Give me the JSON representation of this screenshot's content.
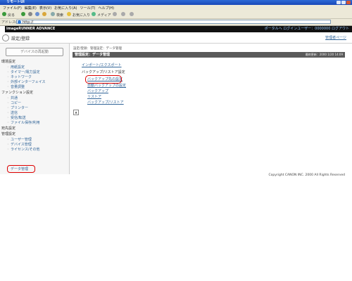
{
  "window": {
    "title": "リモートUI"
  },
  "menubar": {
    "items": [
      "ファイル(F)",
      "編集(E)",
      "表示(V)",
      "お気に入り(A)",
      "ツール(T)",
      "ヘルプ(H)"
    ]
  },
  "toolbar": {
    "back": "戻る",
    "search": "検索",
    "favorites": "お気に入り",
    "media": "メディア"
  },
  "address": {
    "label": "アドレス(D)",
    "value": "http://"
  },
  "app": {
    "brand": "imageRUNNER ADVANCE",
    "logout": "ポータルへ  ログインユーザー：0000000 ログアウト"
  },
  "subheader": {
    "title": "設定/登録",
    "admin_page": "管理者ページ"
  },
  "sidebar": {
    "button": "デバイスの再起動",
    "sections": [
      {
        "heading": "環境設定",
        "items": [
          "用紙設定",
          "タイマー/電力設定",
          "ネットワーク",
          "外部インターフェイス",
          "音量調整"
        ]
      },
      {
        "heading": "ファンクション設定",
        "items": [
          "共通",
          "コピー",
          "プリンター",
          "送信",
          "受信/転送",
          "ファイル保存/利用"
        ]
      },
      {
        "heading": "宛先設定",
        "items": []
      },
      {
        "heading": "管理設定",
        "items": [
          "ユーザー管理",
          "デバイス管理",
          "ライセンス/その他",
          "データ管理"
        ]
      }
    ]
  },
  "main": {
    "breadcrumb": "設定/登録：管理設定：データ管理",
    "title": "管理設定：データ管理",
    "updated": "最終更新：2000 1/20 14:09",
    "links": {
      "import_export": "インポート/エクスポート",
      "backup_heading": "バックアップ/リストア設定",
      "backup_dest": "バックアップ先の設定",
      "auto_backup": "自動バックアップの設定",
      "backup": "バックアップ",
      "restore": "リストア",
      "backup_restore": "バックアップ/リストア"
    }
  },
  "footer": {
    "copyright": "Copyright CANON INC. 2000 All Rights Reserved"
  }
}
